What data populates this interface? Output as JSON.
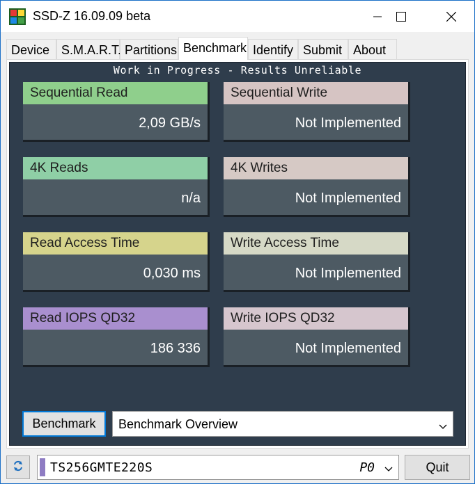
{
  "window": {
    "title": "SSD-Z 16.09.09 beta",
    "icons": {
      "app": "ssd-z-app-icon",
      "minimize": "minimize-icon",
      "maximize": "maximize-icon",
      "close": "close-icon"
    }
  },
  "tabs": [
    {
      "label": "Device",
      "active": false
    },
    {
      "label": "S.M.A.R.T.",
      "active": false
    },
    {
      "label": "Partitions",
      "active": false
    },
    {
      "label": "Benchmark",
      "active": true
    },
    {
      "label": "Identify",
      "active": false
    },
    {
      "label": "Submit",
      "active": false
    },
    {
      "label": "About",
      "active": false
    }
  ],
  "benchmark": {
    "status": "Work in Progress - Results Unreliable",
    "cards": [
      {
        "label": "Sequential Read",
        "value": "2,09 GB/s",
        "color": "#8fcf8c"
      },
      {
        "label": "Sequential Write",
        "value": "Not Implemented",
        "color": "#d6c4c3"
      },
      {
        "label": "4K Reads",
        "value": "n/a",
        "color": "#8fcfa6"
      },
      {
        "label": "4K Writes",
        "value": "Not Implemented",
        "color": "#d6c9c5"
      },
      {
        "label": "Read Access Time",
        "value": "0,030 ms",
        "color": "#d6d48c"
      },
      {
        "label": "Write Access Time",
        "value": "Not Implemented",
        "color": "#d6d9c6"
      },
      {
        "label": "Read IOPS QD32",
        "value": "186 336",
        "color": "#a98fcf"
      },
      {
        "label": "Write IOPS QD32",
        "value": "Not Implemented",
        "color": "#d6c6ce"
      }
    ],
    "run_button": "Benchmark",
    "mode_select": "Benchmark Overview"
  },
  "bottom_bar": {
    "refresh_icon": "refresh-icon",
    "drive_name": "TS256GMTE220S",
    "drive_port": "P0",
    "drive_color": "#8e7cc3",
    "quit_button": "Quit"
  },
  "colors": {
    "bench_background": "#2f3d4c",
    "card_body": "#4d5a63",
    "accent": "#0078d7"
  }
}
